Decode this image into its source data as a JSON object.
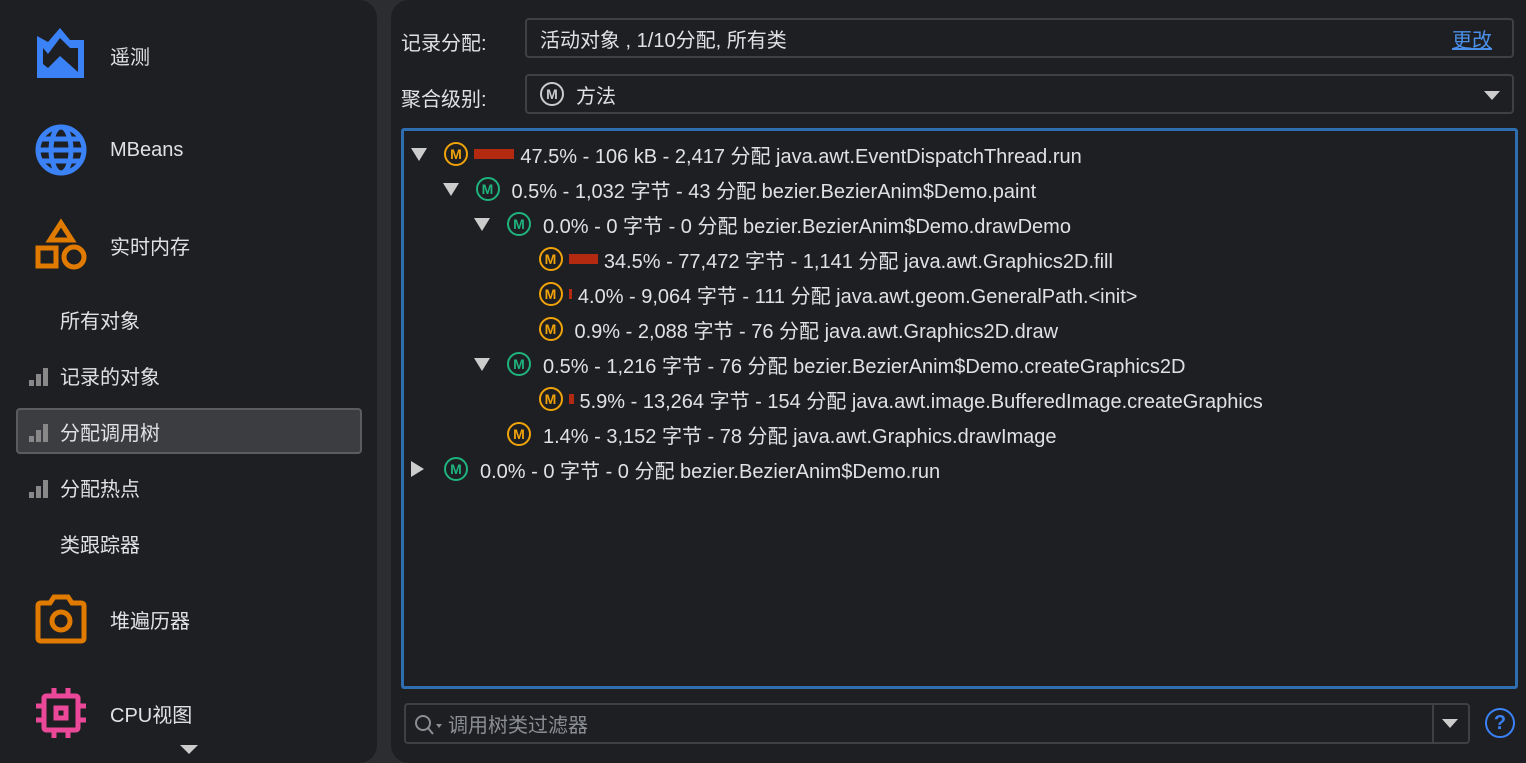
{
  "sidebar": {
    "items": [
      {
        "label": "遥测",
        "icon": "telemetry-icon",
        "color": "#3b82f6"
      },
      {
        "label": "MBeans",
        "icon": "globe-icon",
        "color": "#3b82f6"
      },
      {
        "label": "实时内存",
        "icon": "shapes-icon",
        "color": "#e07b00"
      },
      {
        "label": "堆遍历器",
        "icon": "camera-icon",
        "color": "#e07b00"
      },
      {
        "label": "CPU视图",
        "icon": "cpu-chip-icon",
        "color": "#ec4899"
      }
    ],
    "subitems": [
      {
        "label": "所有对象",
        "bars": false
      },
      {
        "label": "记录的对象",
        "bars": true
      },
      {
        "label": "分配调用树",
        "bars": true,
        "selected": true
      },
      {
        "label": "分配热点",
        "bars": true
      },
      {
        "label": "类跟踪器",
        "bars": false
      }
    ]
  },
  "settings": {
    "record_label": "记录分配:",
    "record_value": "活动对象 , 1/10分配, 所有类",
    "change_link": "更改",
    "aggregation_label": "聚合级别:",
    "aggregation_value": "方法"
  },
  "tree": [
    {
      "level": 0,
      "toggle": "open",
      "color": "#f0a30a",
      "bar_pct": 47.5,
      "text": "47.5% - 106 kB - 2,417 分配 java.awt.EventDispatchThread.run"
    },
    {
      "level": 1,
      "toggle": "open",
      "color": "#1fb37e",
      "bar_pct": 0,
      "text": "0.5% - 1,032 字节 - 43 分配 bezier.BezierAnim$Demo.paint"
    },
    {
      "level": 2,
      "toggle": "open",
      "color": "#1fb37e",
      "bar_pct": 0,
      "text": "0.0% - 0 字节 - 0 分配 bezier.BezierAnim$Demo.drawDemo"
    },
    {
      "level": 3,
      "toggle": "none",
      "color": "#f0a30a",
      "bar_pct": 34.5,
      "text": "34.5% - 77,472 字节 - 1,141 分配 java.awt.Graphics2D.fill"
    },
    {
      "level": 3,
      "toggle": "none",
      "color": "#f0a30a",
      "bar_pct": 4.0,
      "text": "4.0% - 9,064 字节 - 111 分配 java.awt.geom.GeneralPath.<init>"
    },
    {
      "level": 3,
      "toggle": "none",
      "color": "#f0a30a",
      "bar_pct": 0,
      "text": "0.9% - 2,088 字节 - 76 分配 java.awt.Graphics2D.draw"
    },
    {
      "level": 2,
      "toggle": "open",
      "color": "#1fb37e",
      "bar_pct": 0,
      "text": "0.5% - 1,216 字节 - 76 分配 bezier.BezierAnim$Demo.createGraphics2D"
    },
    {
      "level": 3,
      "toggle": "none",
      "color": "#f0a30a",
      "bar_pct": 5.9,
      "text": "5.9% - 13,264 字节 - 154 分配 java.awt.image.BufferedImage.createGraphics"
    },
    {
      "level": 2,
      "toggle": "none",
      "color": "#f0a30a",
      "bar_pct": 0,
      "text": "1.4% - 3,152 字节 - 78 分配 java.awt.Graphics.drawImage"
    },
    {
      "level": 0,
      "toggle": "closed",
      "color": "#1fb37e",
      "bar_pct": 0,
      "text": "0.0% - 0 字节 - 0 分配 bezier.BezierAnim$Demo.run"
    }
  ],
  "method_icon_letter": "M",
  "filter": {
    "placeholder": "调用树类过滤器"
  },
  "help": "?"
}
